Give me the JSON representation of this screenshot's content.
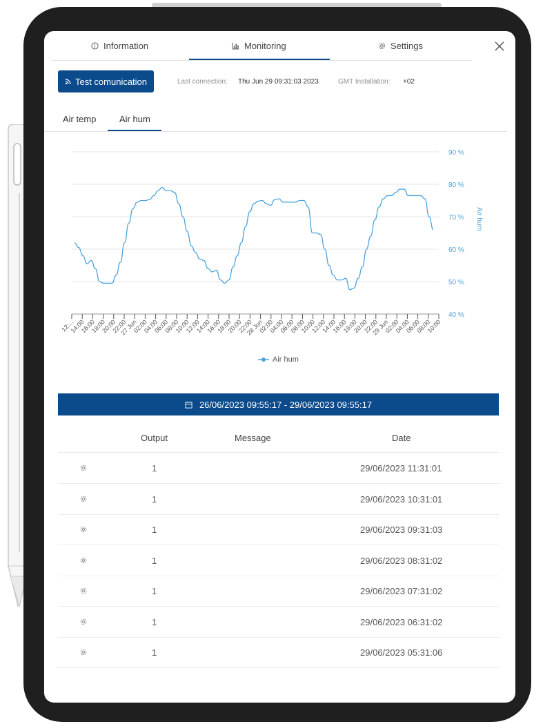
{
  "tabs": [
    {
      "label": "Information",
      "icon": "info-icon"
    },
    {
      "label": "Monitoring",
      "icon": "chart-icon"
    },
    {
      "label": "Settings",
      "icon": "gear-icon"
    }
  ],
  "toolbar": {
    "test_button": "Test comunication",
    "last_connection_label": "Last connection:",
    "last_connection_value": "Thu Jun 29 09:31:03 2023",
    "gmt_label": "GMT Installation:",
    "gmt_value": "+02"
  },
  "subtabs": [
    "Air temp",
    "Air hum"
  ],
  "colors": {
    "primary": "#0b4a8b",
    "series": "#4aa3df"
  },
  "chart_data": {
    "type": "line",
    "x_tick_labels": [
      "12:...",
      "14:00",
      "16:00",
      "18:00",
      "20:00",
      "22:00",
      "27 Jun",
      "02:00",
      "04:00",
      "06:00",
      "08:00",
      "10:00",
      "12:00",
      "14:00",
      "16:00",
      "18:00",
      "20:00",
      "22:00",
      "28 Jun",
      "02:00",
      "04:00",
      "06:00",
      "08:00",
      "10:00",
      "12:00",
      "14:00",
      "16:00",
      "18:00",
      "20:00",
      "22:00",
      "29 Jun",
      "02:00",
      "04:00",
      "06:00",
      "08:00",
      "10:00"
    ],
    "ylabel": "Air hum",
    "y_ticks": [
      "40 %",
      "50 %",
      "60 %",
      "70 %",
      "80 %",
      "90 %"
    ],
    "ylim": [
      40,
      90
    ],
    "grid": true,
    "legend_position": "bottom",
    "series": [
      {
        "name": "Air hum",
        "values": [
          62,
          60.5,
          58,
          55.5,
          56.5,
          54,
          50,
          49.5,
          49.5,
          49.5,
          52,
          56,
          62,
          68,
          72.5,
          74.5,
          75,
          75,
          75.3,
          76.5,
          78,
          79,
          78,
          78,
          77.5,
          74,
          70,
          65.5,
          61,
          59,
          57,
          56.5,
          54,
          53,
          53.5,
          50.5,
          49.5,
          50.5,
          54.5,
          58,
          62,
          67,
          71.5,
          74,
          74.8,
          75,
          74,
          73.5,
          75.3,
          75.5,
          74.5,
          74.5,
          74.5,
          74.5,
          75,
          75,
          73,
          65,
          65,
          64.5,
          60,
          55,
          52,
          50.5,
          50.5,
          51,
          47.5,
          48,
          51,
          54.5,
          60,
          64,
          69,
          73,
          75.5,
          76.5,
          76.5,
          77.5,
          78.5,
          78.5,
          76.5,
          76.5,
          76.5,
          76.5,
          75.5,
          70,
          66
        ]
      }
    ]
  },
  "date_range": "26/06/2023 09:55:17 - 29/06/2023 09:55:17",
  "table": {
    "headers": [
      "Output",
      "Message",
      "Date"
    ],
    "rows": [
      {
        "output": "1",
        "message": "",
        "date": "29/06/2023 11:31:01"
      },
      {
        "output": "1",
        "message": "",
        "date": "29/06/2023 10:31:01"
      },
      {
        "output": "1",
        "message": "",
        "date": "29/06/2023 09:31:03"
      },
      {
        "output": "1",
        "message": "",
        "date": "29/06/2023 08:31:02"
      },
      {
        "output": "1",
        "message": "",
        "date": "29/06/2023 07:31:02"
      },
      {
        "output": "1",
        "message": "",
        "date": "29/06/2023 06:31:02"
      },
      {
        "output": "1",
        "message": "",
        "date": "29/06/2023 05:31:06"
      }
    ]
  }
}
